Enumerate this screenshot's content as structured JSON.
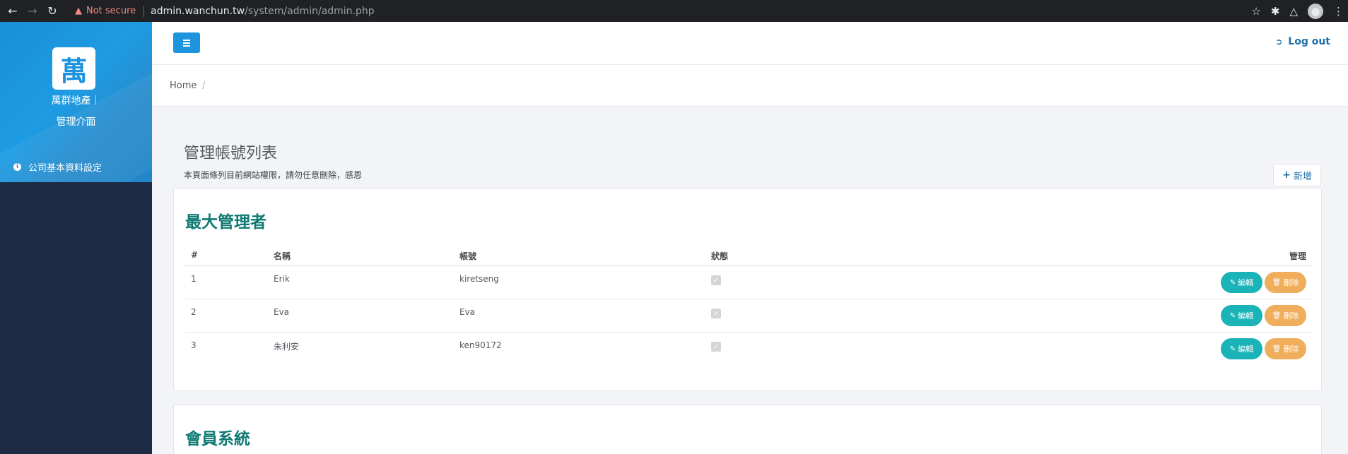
{
  "browser": {
    "security_label": "Not secure",
    "url_host": "admin.wanchun.tw",
    "url_path": "/system/admin/admin.php"
  },
  "sidebar": {
    "logo_char": "萬",
    "brand_line1": "萬群地產｜",
    "brand_line2": "管理介面",
    "items": [
      {
        "label": "公司基本資料設定",
        "icon": "info-icon"
      }
    ]
  },
  "topbar": {
    "logout_label": "Log out"
  },
  "breadcrumb": {
    "home": "Home",
    "separator": "/"
  },
  "page": {
    "title": "管理帳號列表",
    "description": "本頁面條列目前網站權限，請勿任意刪除，感恩",
    "add_label": "新增"
  },
  "sections": [
    {
      "title": "最大管理者",
      "columns": [
        "#",
        "名稱",
        "帳號",
        "狀態",
        "管理"
      ],
      "rows": [
        {
          "num": "1",
          "name": "Erik",
          "account": "kiretseng",
          "status": true
        },
        {
          "num": "2",
          "name": "Eva",
          "account": "Eva",
          "status": true
        },
        {
          "num": "3",
          "name": "朱利安",
          "account": "ken90172",
          "status": true
        }
      ],
      "edit_label": "編輯",
      "delete_label": "刪除"
    },
    {
      "title": "會員系統"
    }
  ],
  "colors": {
    "primary": "#1d94dd",
    "sidebar_bg": "#1d2b44",
    "section_title": "#0f7a73",
    "edit_btn": "#1ab3b8",
    "delete_btn": "#f0ad5b"
  }
}
